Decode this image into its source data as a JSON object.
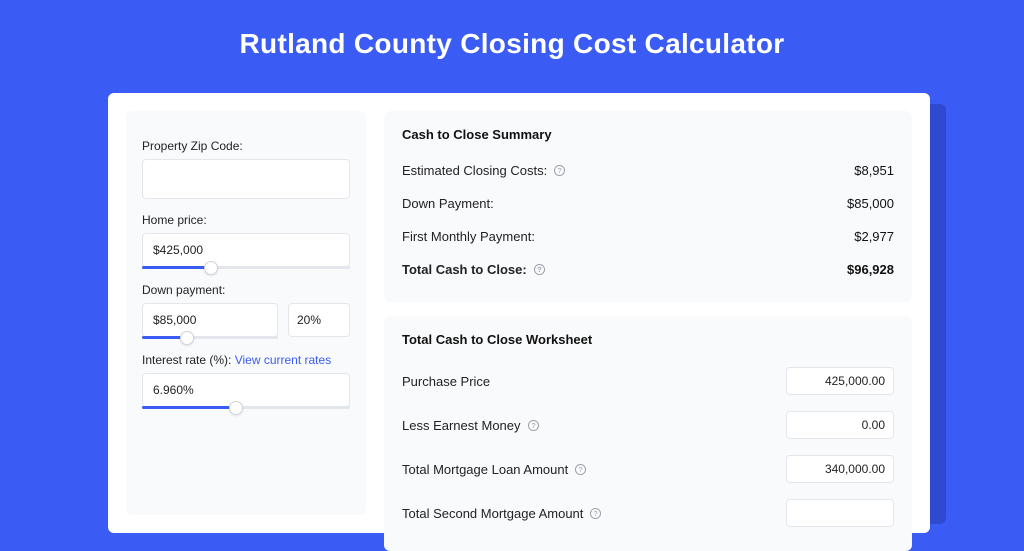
{
  "title": "Rutland County Closing Cost Calculator",
  "inputs": {
    "zip": {
      "label": "Property Zip Code:",
      "value": ""
    },
    "home_price": {
      "label": "Home price:",
      "value": "$425,000",
      "slider_pct": 33
    },
    "down_payment": {
      "label": "Down payment:",
      "value": "$85,000",
      "pct": "20%",
      "slider_pct": 33
    },
    "interest": {
      "label": "Interest rate (%): ",
      "link": "View current rates",
      "value": "6.960%",
      "slider_pct": 45
    }
  },
  "summary": {
    "heading": "Cash to Close Summary",
    "rows": [
      {
        "label": "Estimated Closing Costs:",
        "help": true,
        "value": "$8,951"
      },
      {
        "label": "Down Payment:",
        "help": false,
        "value": "$85,000"
      },
      {
        "label": "First Monthly Payment:",
        "help": false,
        "value": "$2,977"
      }
    ],
    "total": {
      "label": "Total Cash to Close:",
      "help": true,
      "value": "$96,928"
    }
  },
  "worksheet": {
    "heading": "Total Cash to Close Worksheet",
    "rows": [
      {
        "label": "Purchase Price",
        "help": false,
        "value": "425,000.00"
      },
      {
        "label": "Less Earnest Money",
        "help": true,
        "value": "0.00"
      },
      {
        "label": "Total Mortgage Loan Amount",
        "help": true,
        "value": "340,000.00"
      },
      {
        "label": "Total Second Mortgage Amount",
        "help": true,
        "value": ""
      }
    ]
  }
}
